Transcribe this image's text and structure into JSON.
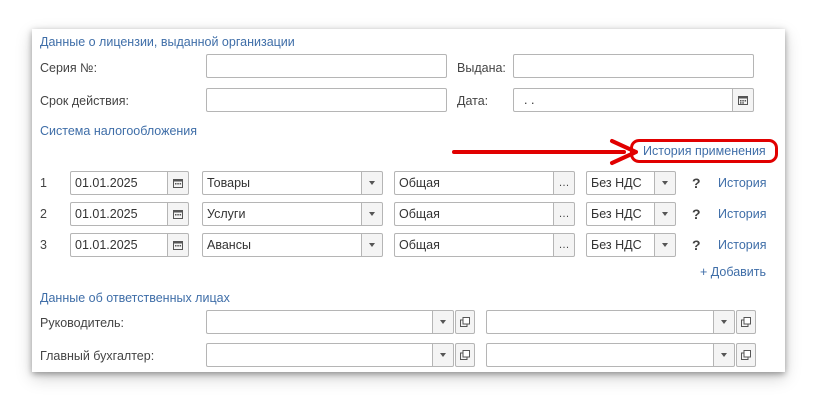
{
  "license": {
    "section_title": "Данные о лицензии, выданной организации",
    "series_label": "Серия №:",
    "series_value": "",
    "issued_label": "Выдана:",
    "issued_value": "",
    "validity_label": "Срок действия:",
    "validity_value": "",
    "date_label": "Дата:",
    "date_value": " .  ."
  },
  "taxation": {
    "section_title": "Система налогообложения",
    "history_link": "История применения",
    "rows": [
      {
        "num": "1",
        "date": "01.01.2025",
        "category": "Товары",
        "system": "Общая",
        "vat": "Без НДС",
        "help": "?",
        "history": "История"
      },
      {
        "num": "2",
        "date": "01.01.2025",
        "category": "Услуги",
        "system": "Общая",
        "vat": "Без НДС",
        "help": "?",
        "history": "История"
      },
      {
        "num": "3",
        "date": "01.01.2025",
        "category": "Авансы",
        "system": "Общая",
        "vat": "Без НДС",
        "help": "?",
        "history": "История"
      }
    ],
    "add_link": "+ Добавить"
  },
  "responsible": {
    "section_title": "Данные об ответственных лицах",
    "director_label": "Руководитель:",
    "director_value": "",
    "director_position": "",
    "accountant_label": "Главный бухгалтер:",
    "accountant_value": "",
    "accountant_position": ""
  },
  "annotation": {
    "color": "#e10000",
    "arrow": "right",
    "highlight_target": "history-link"
  },
  "icons": {
    "calendar": "calendar-icon",
    "dropdown": "chevron-down-icon",
    "select": "ellipsis-icon",
    "open": "open-form-icon",
    "help": "question-icon"
  }
}
